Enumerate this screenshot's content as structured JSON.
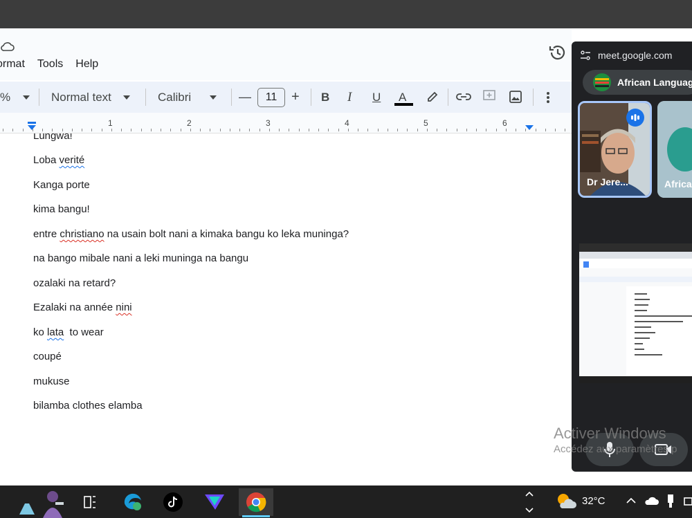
{
  "menubar": {
    "items": [
      "ormat",
      "Tools",
      "Help"
    ]
  },
  "toolbar": {
    "zoom_suffix": "%",
    "style_select": "Normal text",
    "font_select": "Calibri",
    "font_size": "11",
    "minus": "—",
    "plus": "+",
    "bold": "B",
    "italic": "I",
    "underline": "U",
    "text_color": "A"
  },
  "ruler": {
    "numbers": [
      "1",
      "2",
      "3",
      "4",
      "5",
      "6"
    ]
  },
  "document": {
    "lines": [
      "Lungwa!",
      "Loba verité",
      "Kanga porte",
      "kima bangu!",
      "entre christiano na usain bolt nani a kimaka bangu ko leka muninga?",
      "na bango mibale nani a leki muninga na bangu",
      "ozalaki na retard?",
      "Ezalaki na année nini",
      "ko lata  to wear",
      "coupé",
      "mukuse",
      "bilamba clothes elamba"
    ],
    "flagged_words": {
      "line1": "verité",
      "line4": "christiano",
      "line7": "nini",
      "line8": "lata"
    }
  },
  "meet": {
    "url": "meet.google.com",
    "meeting_title": "African Language",
    "tiles": [
      {
        "name": "Dr Jere..."
      },
      {
        "name": "Africa"
      }
    ]
  },
  "watermark": {
    "line1": "Activer Windows",
    "line2": "Accédez aux paramètres p"
  },
  "taskbar": {
    "temperature": "32°C"
  },
  "colors": {
    "docs_bg": "#f9fbfd",
    "toolbar_bg": "#edf2fa",
    "meet_bg": "#202124",
    "taskbar_bg": "#202020",
    "accent_blue": "#1a73e8",
    "speaking_ring": "#a8c7fa"
  },
  "icons": [
    "cloud-icon",
    "history-icon",
    "link-icon",
    "add-comment-icon",
    "image-icon",
    "more-icon",
    "highlighter-icon",
    "mic-icon",
    "camera-icon",
    "tune-icon",
    "weather-icon",
    "chrome-icon",
    "tiktok-icon",
    "proton-vpn-icon",
    "task-view-icon",
    "edge-icon"
  ]
}
